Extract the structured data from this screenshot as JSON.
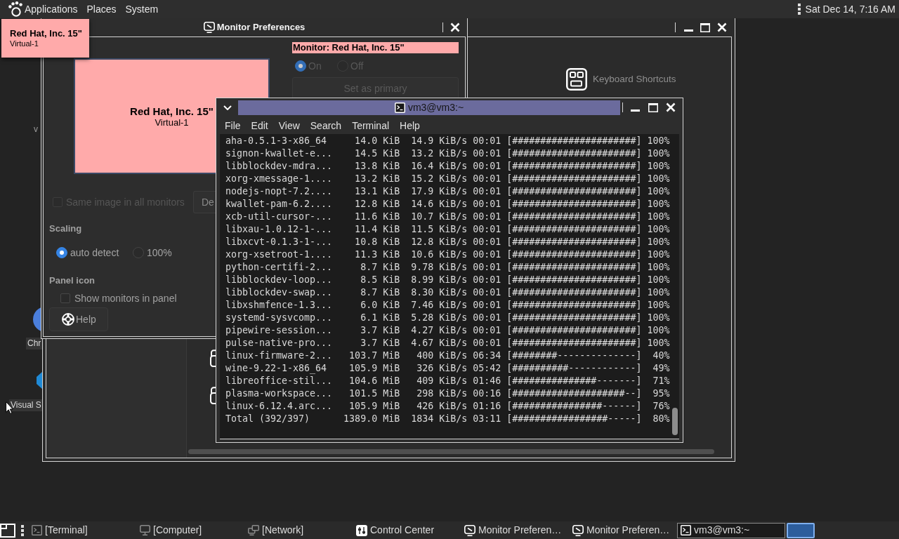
{
  "top_panel": {
    "menus": [
      "Applications",
      "Places",
      "System"
    ],
    "clock": "Sat Dec 14, 7:16 AM"
  },
  "identify_popup": {
    "name": "Red Hat, Inc. 15\"",
    "output": "Virtual-1"
  },
  "monitor_preferences": {
    "title": "Monitor Preferences",
    "monitor_tile": {
      "name": "Red Hat, Inc. 15\"",
      "output": "Virtual-1"
    },
    "monitor_heading": "Monitor: Red Hat, Inc. 15\"",
    "power": [
      {
        "label": "On",
        "selected": true,
        "disabled": true
      },
      {
        "label": "Off",
        "selected": false,
        "disabled": true
      }
    ],
    "primary_button": {
      "label": "Set as primary",
      "disabled": true
    },
    "same_image": {
      "label": "Same image in all monitors",
      "checked": false,
      "disabled": true
    },
    "detect_button": {
      "label": "De"
    },
    "scaling": {
      "heading": "Scaling",
      "options": [
        {
          "label": "auto detect",
          "selected": true
        },
        {
          "label": "100%",
          "selected": false
        }
      ]
    },
    "panel_icon": {
      "heading": "Panel icon",
      "show_monitors": {
        "label": "Show monitors in panel",
        "checked": false
      }
    },
    "help_button": {
      "label": "Help"
    }
  },
  "control_center": {
    "items": [
      {
        "label": "Keyboard Shortcuts"
      }
    ]
  },
  "terminal": {
    "title": "vm3@vm3:~",
    "menus": [
      "File",
      "Edit",
      "View",
      "Search",
      "Terminal",
      "Help"
    ],
    "lines": [
      "aha-0.5.1-3-x86_64     14.0 KiB  14.9 KiB/s 00:01 [######################] 100%",
      "signon-kwallet-e...    14.5 KiB  13.2 KiB/s 00:01 [######################] 100%",
      "libblockdev-mdra...    13.8 KiB  16.4 KiB/s 00:01 [######################] 100%",
      "xorg-xmessage-1....    13.2 KiB  15.2 KiB/s 00:01 [######################] 100%",
      "nodejs-nopt-7.2....    13.1 KiB  17.9 KiB/s 00:01 [######################] 100%",
      "kwallet-pam-6.2....    12.8 KiB  14.6 KiB/s 00:01 [######################] 100%",
      "xcb-util-cursor-...    11.6 KiB  10.7 KiB/s 00:01 [######################] 100%",
      "libxau-1.0.12-1-...    11.4 KiB  11.5 KiB/s 00:01 [######################] 100%",
      "libxcvt-0.1.3-1-...    10.8 KiB  12.8 KiB/s 00:01 [######################] 100%",
      "xorg-xsetroot-1....    11.3 KiB  10.6 KiB/s 00:01 [######################] 100%",
      "python-certifi-2...     8.7 KiB  9.78 KiB/s 00:01 [######################] 100%",
      "libblockdev-loop...     8.5 KiB  8.99 KiB/s 00:01 [######################] 100%",
      "libblockdev-swap...     8.7 KiB  8.30 KiB/s 00:01 [######################] 100%",
      "libxshmfence-1.3...     6.0 KiB  7.46 KiB/s 00:01 [######################] 100%",
      "systemd-sysvcomp...     6.1 KiB  5.28 KiB/s 00:01 [######################] 100%",
      "pipewire-session...     3.7 KiB  4.27 KiB/s 00:01 [######################] 100%",
      "pulse-native-pro...     3.7 KiB  4.67 KiB/s 00:01 [######################] 100%",
      "linux-firmware-2...   103.7 MiB   400 KiB/s 06:34 [########--------------]  40%",
      "wine-9.22-1-x86_64    105.9 MiB   326 KiB/s 05:42 [##########------------]  49%",
      "libreoffice-stil...   104.6 MiB   409 KiB/s 01:46 [###############-------]  71%",
      "plasma-workspace...   101.5 MiB   298 KiB/s 00:16 [####################--]  95%",
      "linux-6.12.4.arc...   105.9 MiB   426 KiB/s 01:16 [################------]  76%",
      "Total (392/397)      1389.0 MiB  1834 KiB/s 03:11 [#################-----]  80%"
    ]
  },
  "desktop_icons": [
    {
      "label": "v",
      "kind": "text"
    },
    {
      "label": "Chr",
      "kind": "round"
    },
    {
      "label": "Visual S",
      "kind": "ribbon"
    }
  ],
  "taskbar": {
    "items": [
      {
        "label": "[Terminal]",
        "kind": "terminal",
        "minimized": true,
        "selected": false
      },
      {
        "label": "[Computer]",
        "kind": "computer",
        "minimized": true,
        "selected": false
      },
      {
        "label": "[Network]",
        "kind": "network",
        "minimized": true,
        "selected": false
      },
      {
        "label": "Control Center",
        "kind": "settings",
        "minimized": false,
        "selected": false
      },
      {
        "label": "Monitor Preferen…",
        "kind": "monitor",
        "minimized": false,
        "selected": false
      },
      {
        "label": "Monitor Preferen…",
        "kind": "monitor",
        "minimized": false,
        "selected": false
      },
      {
        "label": "vm3@vm3:~",
        "kind": "terminal",
        "minimized": false,
        "selected": true
      }
    ]
  }
}
